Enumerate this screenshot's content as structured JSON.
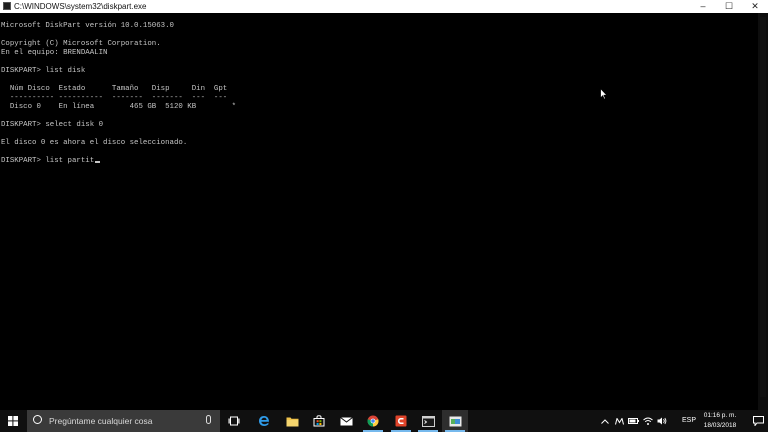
{
  "window": {
    "title": "C:\\WINDOWS\\system32\\diskpart.exe",
    "controls": [
      "–",
      "☐",
      "✕"
    ]
  },
  "console": {
    "lines": [
      "Microsoft DiskPart versión 10.0.15063.0",
      "",
      "Copyright (C) Microsoft Corporation.",
      "En el equipo: BRENDAALIN",
      "",
      "DISKPART> list disk",
      "",
      "  Núm Disco  Estado      Tamaño   Disp     Din  Gpt",
      "  ---------- ----------  -------  -------  ---  ---",
      "  Disco 0    En línea        465 GB  5120 KB        *",
      "",
      "DISKPART> select disk 0",
      "",
      "El disco 0 es ahora el disco seleccionado.",
      "",
      "DISKPART> list partit"
    ]
  },
  "taskbar": {
    "search_placeholder": "Pregúntame cualquier cosa",
    "language": "ESP",
    "time": "01:16 p. m.",
    "date": "18/03/2018"
  },
  "icons": {
    "start": "windows-logo-icon",
    "search": "cortana-circle-icon",
    "mic": "microphone-icon",
    "task_view": "task-view-icon",
    "edge": "edge-icon",
    "explorer": "file-explorer-icon",
    "store": "store-icon",
    "mail": "mail-icon",
    "chrome": "chrome-icon",
    "app": "red-app-icon",
    "cmd": "command-prompt-icon",
    "diskpart": "diskpart-icon"
  },
  "colors": {
    "console_bg": "#000000",
    "console_text": "#c6c6c6",
    "taskbar_bg": "#101010",
    "accent": "#76b9ed"
  }
}
